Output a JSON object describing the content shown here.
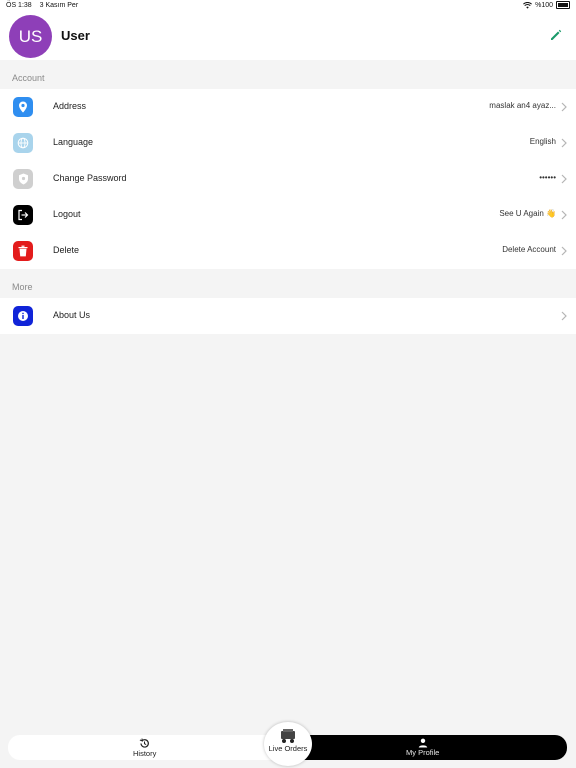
{
  "status_bar": {
    "time": "ÖS 1:38",
    "date": "3 Kasım Per",
    "battery": "%100"
  },
  "profile": {
    "avatar_initials": "US",
    "name": "User"
  },
  "sections": {
    "account": {
      "title": "Account",
      "items": [
        {
          "label": "Address",
          "value": "maslak an4 ayaz...",
          "icon": "location-pin-icon",
          "color": "#2f8ef0"
        },
        {
          "label": "Language",
          "value": "English",
          "icon": "globe-icon",
          "color": "#a9d4ec"
        },
        {
          "label": "Change Password",
          "value": "••••••",
          "icon": "shield-icon",
          "color": "#cfcfcf"
        },
        {
          "label": "Logout",
          "value": "See U Again 👋",
          "icon": "logout-icon",
          "color": "#000000"
        },
        {
          "label": "Delete",
          "value": "Delete Account",
          "icon": "trash-icon",
          "color": "#e31c1c"
        }
      ]
    },
    "more": {
      "title": "More",
      "items": [
        {
          "label": "About Us",
          "value": "",
          "icon": "info-icon",
          "color": "#1024d8"
        }
      ]
    }
  },
  "tabbar": {
    "history": "History",
    "live_orders": "Live Orders",
    "my_profile": "My Profile"
  }
}
